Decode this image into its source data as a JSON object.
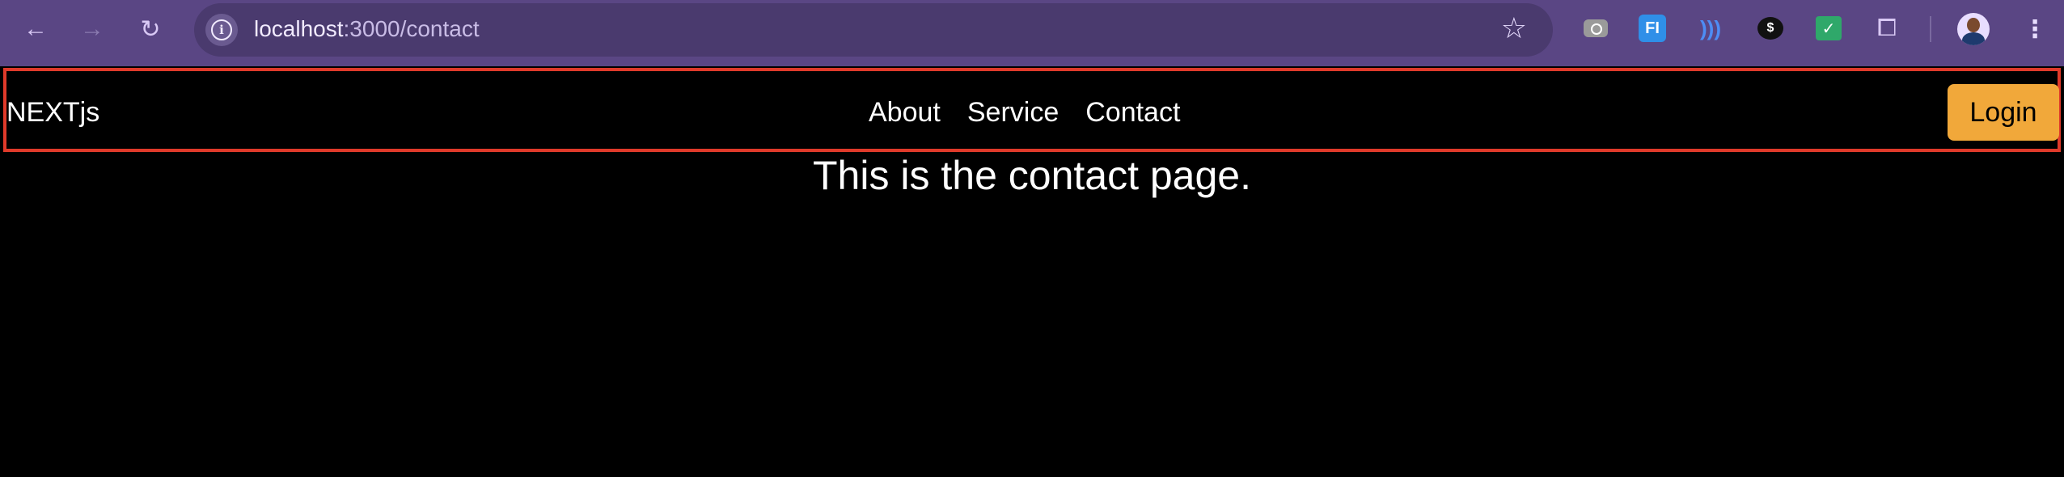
{
  "browser": {
    "url_host": "localhost",
    "url_path": ":3000/contact",
    "icons": [
      "back-icon",
      "forward-icon",
      "reload-icon",
      "info-icon",
      "star-icon",
      "camera-extension-icon",
      "fi-extension-icon",
      "wave-extension-icon",
      "chat-extension-icon",
      "mail-extension-icon",
      "puzzle-icon",
      "avatar",
      "menu-icon"
    ],
    "ext_fi_label": "FI",
    "ext_chat_label": "$"
  },
  "navbar": {
    "brand": "NEXTjs",
    "links": [
      {
        "label": "About"
      },
      {
        "label": "Service"
      },
      {
        "label": "Contact"
      }
    ],
    "login_label": "Login",
    "highlight_color": "#e03a2a",
    "login_color": "#f1a83a"
  },
  "main": {
    "heading": "This is the contact page."
  }
}
